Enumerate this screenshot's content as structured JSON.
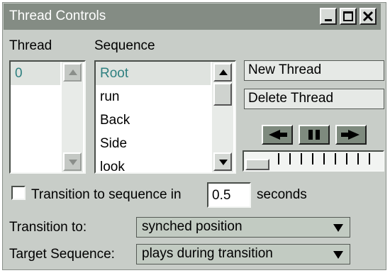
{
  "window": {
    "title": "Thread Controls",
    "controls": [
      "minimize",
      "maximize",
      "close"
    ]
  },
  "thread_panel": {
    "label": "Thread",
    "items": [
      "0"
    ],
    "selected": "0"
  },
  "sequence_panel": {
    "label": "Sequence",
    "items": [
      "Root",
      "run",
      "Back",
      "Side",
      "look"
    ],
    "selected": "Root"
  },
  "buttons": {
    "new_thread": "New Thread",
    "delete_thread": "Delete Thread"
  },
  "playback": {
    "controls": [
      "step-back-icon",
      "pause-icon",
      "step-forward-icon"
    ],
    "position_fraction": 0.0
  },
  "transition": {
    "checkbox_checked": false,
    "label_before": "Transition to sequence in",
    "duration_value": "0.5",
    "label_after": "seconds"
  },
  "transition_to": {
    "label": "Transition to:",
    "selected": "synched position"
  },
  "target_sequence": {
    "label": "Target Sequence:",
    "selected": "plays during transition"
  },
  "colors": {
    "titlebar": "#848c84",
    "panel": "#c8cdc8",
    "selected_text": "#2f8080",
    "dropdown_bg": "#c2cbc2"
  }
}
